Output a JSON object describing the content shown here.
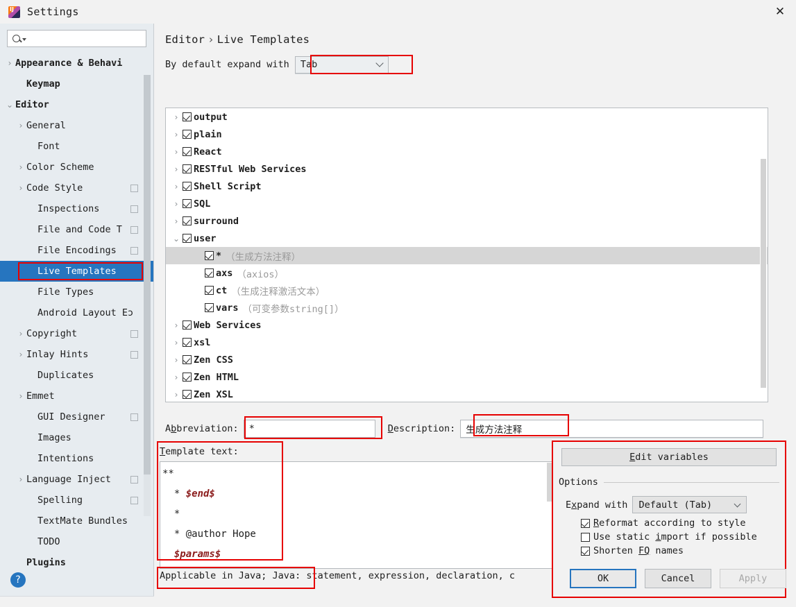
{
  "window": {
    "title": "Settings",
    "app_icon": "intellij-idea-icon",
    "close_icon": "close-icon"
  },
  "sidebar": {
    "search": {
      "placeholder": "",
      "value": "",
      "icon": "search-icon"
    },
    "items": [
      {
        "label": "Appearance & Behavi",
        "arrow": "›",
        "indent": 0,
        "bold": true,
        "badge": false,
        "selected": false
      },
      {
        "label": "Keymap",
        "arrow": "",
        "indent": 1,
        "bold": true,
        "badge": false,
        "selected": false
      },
      {
        "label": "Editor",
        "arrow": "⌄",
        "indent": 0,
        "bold": true,
        "badge": false,
        "selected": false
      },
      {
        "label": "General",
        "arrow": "›",
        "indent": 1,
        "bold": false,
        "badge": false,
        "selected": false
      },
      {
        "label": "Font",
        "arrow": "",
        "indent": 2,
        "bold": false,
        "badge": false,
        "selected": false
      },
      {
        "label": "Color Scheme",
        "arrow": "›",
        "indent": 1,
        "bold": false,
        "badge": false,
        "selected": false
      },
      {
        "label": "Code Style",
        "arrow": "›",
        "indent": 1,
        "bold": false,
        "badge": true,
        "selected": false
      },
      {
        "label": "Inspections",
        "arrow": "",
        "indent": 2,
        "bold": false,
        "badge": true,
        "selected": false
      },
      {
        "label": "File and Code T",
        "arrow": "",
        "indent": 2,
        "bold": false,
        "badge": true,
        "selected": false
      },
      {
        "label": "File Encodings",
        "arrow": "",
        "indent": 2,
        "bold": false,
        "badge": true,
        "selected": false
      },
      {
        "label": "Live Templates",
        "arrow": "",
        "indent": 2,
        "bold": false,
        "badge": false,
        "selected": true
      },
      {
        "label": "File Types",
        "arrow": "",
        "indent": 2,
        "bold": false,
        "badge": false,
        "selected": false
      },
      {
        "label": "Android Layout Eɔ",
        "arrow": "",
        "indent": 2,
        "bold": false,
        "badge": false,
        "selected": false
      },
      {
        "label": "Copyright",
        "arrow": "›",
        "indent": 1,
        "bold": false,
        "badge": true,
        "selected": false
      },
      {
        "label": "Inlay Hints",
        "arrow": "›",
        "indent": 1,
        "bold": false,
        "badge": true,
        "selected": false
      },
      {
        "label": "Duplicates",
        "arrow": "",
        "indent": 2,
        "bold": false,
        "badge": false,
        "selected": false
      },
      {
        "label": "Emmet",
        "arrow": "›",
        "indent": 1,
        "bold": false,
        "badge": false,
        "selected": false
      },
      {
        "label": "GUI Designer",
        "arrow": "",
        "indent": 2,
        "bold": false,
        "badge": true,
        "selected": false
      },
      {
        "label": "Images",
        "arrow": "",
        "indent": 2,
        "bold": false,
        "badge": false,
        "selected": false
      },
      {
        "label": "Intentions",
        "arrow": "",
        "indent": 2,
        "bold": false,
        "badge": false,
        "selected": false
      },
      {
        "label": "Language Inject",
        "arrow": "›",
        "indent": 1,
        "bold": false,
        "badge": true,
        "selected": false
      },
      {
        "label": "Spelling",
        "arrow": "",
        "indent": 2,
        "bold": false,
        "badge": true,
        "selected": false
      },
      {
        "label": "TextMate Bundles",
        "arrow": "",
        "indent": 2,
        "bold": false,
        "badge": false,
        "selected": false
      },
      {
        "label": "TODO",
        "arrow": "",
        "indent": 2,
        "bold": false,
        "badge": false,
        "selected": false
      },
      {
        "label": "Plugins",
        "arrow": "",
        "indent": 1,
        "bold": true,
        "badge": false,
        "selected": false
      }
    ],
    "help_label": "?"
  },
  "main": {
    "breadcrumb": {
      "root": "Editor",
      "separator": "›",
      "leaf": "Live Templates"
    },
    "expand_with": {
      "label": "By default expand with",
      "value": "Tab"
    },
    "tree": [
      {
        "arrow": "›",
        "child": false,
        "checked": true,
        "name": "output",
        "desc": ""
      },
      {
        "arrow": "›",
        "child": false,
        "checked": true,
        "name": "plain",
        "desc": ""
      },
      {
        "arrow": "›",
        "child": false,
        "checked": true,
        "name": "React",
        "desc": ""
      },
      {
        "arrow": "›",
        "child": false,
        "checked": true,
        "name": "RESTful Web Services",
        "desc": ""
      },
      {
        "arrow": "›",
        "child": false,
        "checked": true,
        "name": "Shell Script",
        "desc": ""
      },
      {
        "arrow": "›",
        "child": false,
        "checked": true,
        "name": "SQL",
        "desc": ""
      },
      {
        "arrow": "›",
        "child": false,
        "checked": true,
        "name": "surround",
        "desc": ""
      },
      {
        "arrow": "⌄",
        "child": false,
        "checked": true,
        "name": "user",
        "desc": ""
      },
      {
        "arrow": "",
        "child": true,
        "checked": true,
        "name": "*",
        "desc": "（生成方法注释）",
        "selected": true
      },
      {
        "arrow": "",
        "child": true,
        "checked": true,
        "name": "axs",
        "desc": "（axios）"
      },
      {
        "arrow": "",
        "child": true,
        "checked": true,
        "name": "ct",
        "desc": "（生成注释激活文本）"
      },
      {
        "arrow": "",
        "child": true,
        "checked": true,
        "name": "vars",
        "desc": "（可变参数string[]）"
      },
      {
        "arrow": "›",
        "child": false,
        "checked": true,
        "name": "Web Services",
        "desc": ""
      },
      {
        "arrow": "›",
        "child": false,
        "checked": true,
        "name": "xsl",
        "desc": ""
      },
      {
        "arrow": "›",
        "child": false,
        "checked": true,
        "name": "Zen CSS",
        "desc": ""
      },
      {
        "arrow": "›",
        "child": false,
        "checked": true,
        "name": "Zen HTML",
        "desc": ""
      },
      {
        "arrow": "›",
        "child": false,
        "checked": true,
        "name": "Zen XSL",
        "desc": ""
      }
    ],
    "toolbar": {
      "add": "+",
      "remove": "−",
      "duplicate": "copy-icon",
      "revert": "revert-icon"
    },
    "abbreviation": {
      "label_pre": "A",
      "label_underlined": "b",
      "label_post": "breviation:",
      "value": "*"
    },
    "description": {
      "label_underlined": "D",
      "label_post": "escription:",
      "value": "生成方法注释"
    },
    "template_text": {
      "label_underlined": "T",
      "label_post": "emplate text:",
      "lines": [
        {
          "plain": "**",
          "var": ""
        },
        {
          "plain": "  * ",
          "var": "$end$"
        },
        {
          "plain": "  *",
          "var": ""
        },
        {
          "plain": "  * @author Hope",
          "var": ""
        },
        {
          "plain": "  ",
          "var": "$params$"
        }
      ]
    },
    "status": "Applicable in Java; Java: statement, expression, declaration, c"
  },
  "options_panel": {
    "edit_variables": {
      "underlined": "E",
      "rest": "dit variables"
    },
    "legend": "Options",
    "expand_with": {
      "pre": "E",
      "underlined": "x",
      "post": "pand with",
      "value": "Default (Tab)"
    },
    "checkboxes": [
      {
        "pre": "",
        "underlined": "R",
        "post": "eformat according to style",
        "checked": true
      },
      {
        "pre": "Use static ",
        "underlined": "i",
        "post": "mport if possible",
        "checked": false
      },
      {
        "pre": "Shorten ",
        "underlined": "FQ",
        "post": " names",
        "checked": true
      }
    ]
  },
  "buttons": {
    "ok": "OK",
    "cancel": "Cancel",
    "apply": "Apply"
  },
  "colors": {
    "accent": "#2675bf",
    "highlight": "#e60000",
    "sidebar_bg": "#e7ecf0",
    "panel_bg": "#f2f2f2",
    "template_var": "#8b1c1c"
  }
}
